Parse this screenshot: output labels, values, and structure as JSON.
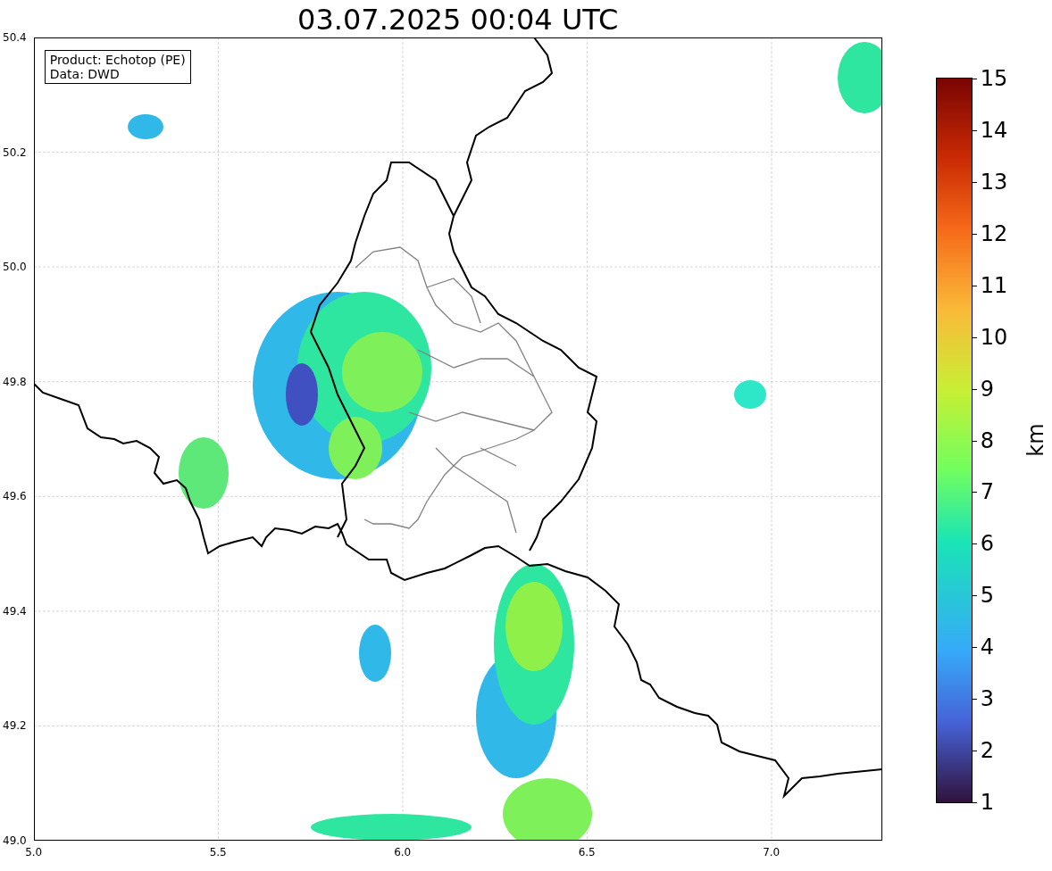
{
  "title": "03.07.2025 00:04 UTC",
  "legend": [
    "Product: Echotop (PE)",
    "Data: DWD"
  ],
  "y_ticks": [
    "50.4",
    "50.2",
    "50.0",
    "49.8",
    "49.6",
    "49.4",
    "49.2",
    "49.0"
  ],
  "x_ticks": [
    "5.0",
    "5.5",
    "6.0",
    "6.5",
    "7.0"
  ],
  "colorbar": {
    "label": "km",
    "ticks": [
      "15",
      "14",
      "13",
      "12",
      "11",
      "10",
      "9",
      "8",
      "7",
      "6",
      "5",
      "4",
      "3",
      "2",
      "1"
    ]
  }
}
